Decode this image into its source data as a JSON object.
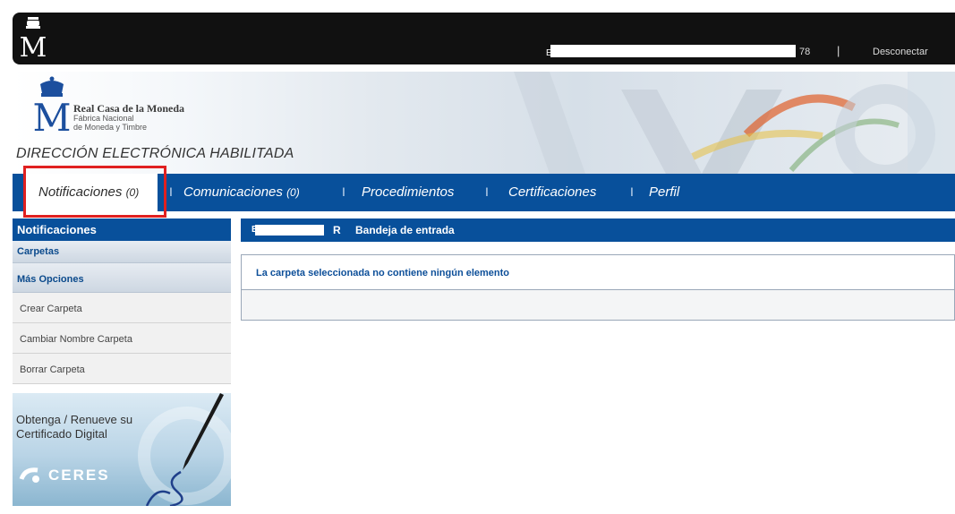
{
  "topbar": {
    "user_prefix": "E",
    "user_suffix": "78",
    "separator": "|",
    "logout_label": "Desconectar"
  },
  "banner": {
    "brand_line1": "Real Casa de la Moneda",
    "brand_line2": "Fábrica Nacional",
    "brand_line3": "de Moneda y Timbre",
    "subtitle": "DIRECCIÓN ELECTRÓNICA HABILITADA"
  },
  "nav": {
    "tabs": [
      {
        "label": "Notificaciones",
        "count": "(0)"
      },
      {
        "label": "Comunicaciones",
        "count": "(0)"
      },
      {
        "label": "Procedimientos",
        "count": ""
      },
      {
        "label": "Certificaciones",
        "count": ""
      },
      {
        "label": "Perfil",
        "count": ""
      }
    ],
    "separator": "I"
  },
  "sidebar": {
    "title": "Notificaciones",
    "sections": [
      {
        "label": "Carpetas"
      },
      {
        "label": "Más Opciones"
      }
    ],
    "items": [
      {
        "label": "Crear Carpeta"
      },
      {
        "label": "Cambiar Nombre Carpeta"
      },
      {
        "label": "Borrar Carpeta"
      }
    ],
    "promo": {
      "text": "Obtenga / Renueve su Certificado Digital",
      "brand": "CERES"
    }
  },
  "main": {
    "header_prefix": "E",
    "header_suffix": "R",
    "header_title": "Bandeja de entrada",
    "empty_message": "La carpeta seleccionada no contiene ningún elemento"
  },
  "colors": {
    "primary_blue": "#08509b",
    "topbar_black": "#111111",
    "highlight_red": "#e02020",
    "link_blue": "#0d4f99"
  }
}
